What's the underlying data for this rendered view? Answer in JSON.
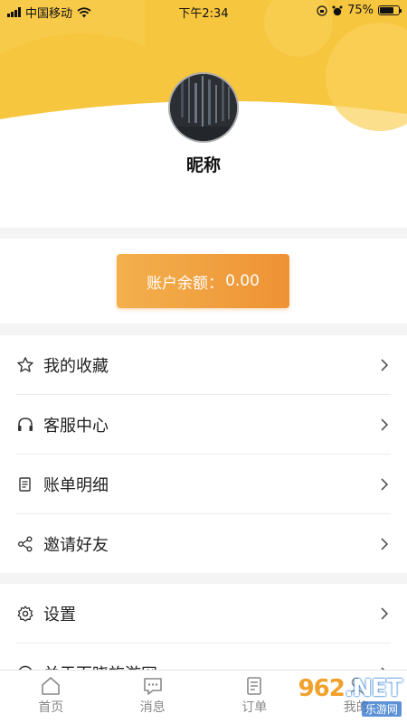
{
  "status_bar": {
    "carrier": "中国移动",
    "time": "下午2:34",
    "battery": "75%",
    "battery_level": 0.75
  },
  "profile": {
    "nickname": "昵称"
  },
  "balance": {
    "label": "账户余额：",
    "value": "0.00"
  },
  "menu_group_1": [
    {
      "icon": "star-icon",
      "label": "我的收藏"
    },
    {
      "icon": "headset-icon",
      "label": "客服中心"
    },
    {
      "icon": "document-icon",
      "label": "账单明细"
    },
    {
      "icon": "share-icon",
      "label": "邀请好友"
    }
  ],
  "menu_group_2": [
    {
      "icon": "gear-icon",
      "label": "设置"
    },
    {
      "icon": "info-icon",
      "label": "关于百晓旅游网"
    }
  ],
  "tabs": [
    {
      "icon": "home-icon",
      "label": "首页"
    },
    {
      "icon": "message-icon",
      "label": "消息"
    },
    {
      "icon": "order-icon",
      "label": "订单"
    },
    {
      "icon": "profile-icon",
      "label": "我的"
    }
  ],
  "watermark": {
    "brand": "962",
    "suffix": ".NET",
    "sub": "乐游网"
  },
  "colors": {
    "header_yellow": "#f7c63f",
    "accent_orange": "#ee9235",
    "text": "#222222",
    "tab_grey": "#888888"
  }
}
